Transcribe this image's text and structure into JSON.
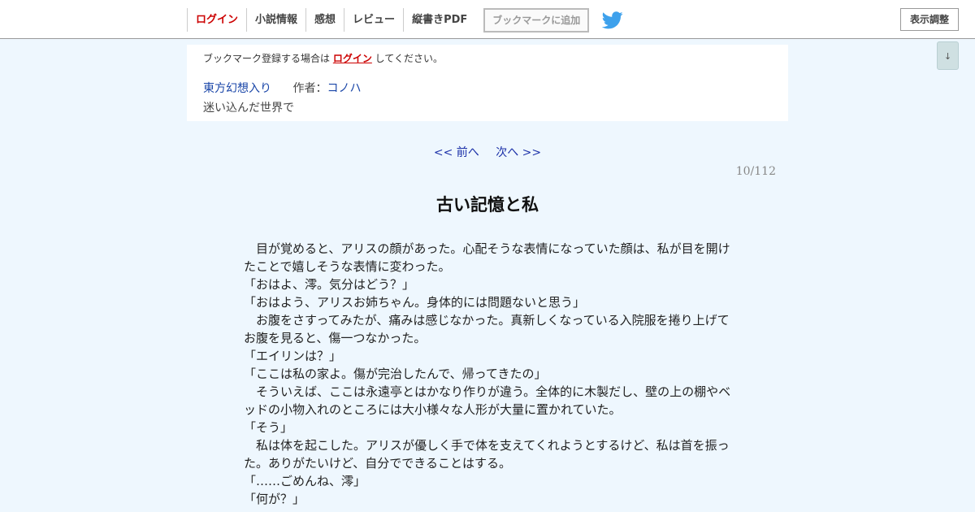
{
  "header": {
    "nav": [
      {
        "id": "login",
        "label": "ログイン"
      },
      {
        "id": "novel-info",
        "label": "小説情報"
      },
      {
        "id": "impressions",
        "label": "感想"
      },
      {
        "id": "review",
        "label": "レビュー"
      },
      {
        "id": "vertical-pdf",
        "label": "縦書きPDF"
      }
    ],
    "bookmark_label": "ブックマークに追加",
    "display_settings_label": "表示調整",
    "scroll_down_label": "↓"
  },
  "info": {
    "bookmark_note_before": "ブックマーク登録する場合は ",
    "bookmark_note_link": "ログイン",
    "bookmark_note_after": " してください。",
    "novel_title": "東方幻想入り",
    "author_label": "作者：",
    "author_name": "コノハ",
    "subtitle": "迷い込んだ世界で"
  },
  "pager": {
    "prev": "<< 前へ",
    "next": "次へ >>",
    "count": "10/112"
  },
  "chapter": {
    "title": "古い記憶と私",
    "paragraphs": [
      "　目が覚めると、アリスの顔があった。心配そうな表情になっていた顔は、私が目を開けたことで嬉しそうな表情に変わった。",
      "「おはよ、澪。気分はどう？」",
      "「おはよう、アリスお姉ちゃん。身体的には問題ないと思う」",
      "　お腹をさすってみたが、痛みは感じなかった。真新しくなっている入院服を捲り上げてお腹を見ると、傷一つなかった。",
      "「エイリンは？」",
      "「ここは私の家よ。傷が完治したんで、帰ってきたの」",
      "　そういえば、ここは永遠亭とはかなり作りが違う。全体的に木製だし、壁の上の棚やベッドの小物入れのところには大小様々な人形が大量に置かれていた。",
      "「そう」",
      "　私は体を起こした。アリスが優しく手で体を支えてくれようとするけど、私は首を振った。ありがたいけど、自分でできることはする。",
      "「……ごめんね、澪」",
      "「何が？」"
    ]
  },
  "colors": {
    "page_bg": "#eef7fe",
    "login_red": "#cc0000",
    "link_blue": "#1a46a8",
    "twitter_blue": "#1da1f2"
  },
  "icons": {
    "twitter": "twitter-bird-icon",
    "scroll": "down-arrow-icon"
  }
}
